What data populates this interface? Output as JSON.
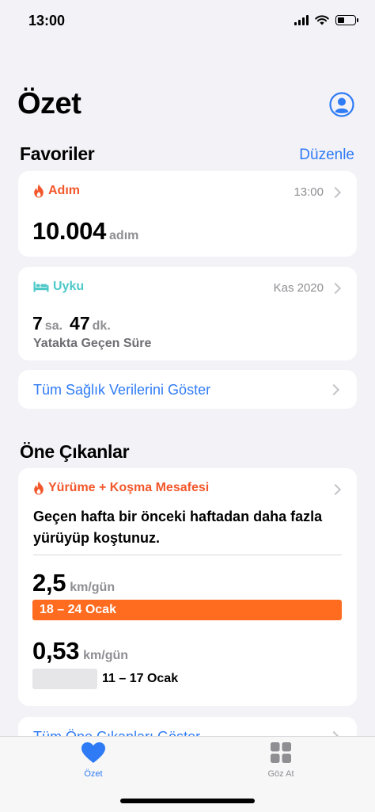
{
  "status": {
    "time": "13:00"
  },
  "header": {
    "title": "Özet"
  },
  "favorites": {
    "title": "Favoriler",
    "edit_label": "Düzenle",
    "steps": {
      "label": "Adım",
      "time": "13:00",
      "value": "10.004",
      "unit": "adım"
    },
    "sleep": {
      "label": "Uyku",
      "date": "Kas 2020",
      "hours": "7",
      "hours_unit": "sa.",
      "minutes": "47",
      "minutes_unit": "dk.",
      "caption": "Yatakta Geçen Süre"
    },
    "show_all": "Tüm Sağlık Verilerini Göster"
  },
  "highlights": {
    "title": "Öne Çıkanlar",
    "card": {
      "label": "Yürüme + Koşma Mesafesi",
      "description": "Geçen hafta bir önceki haftadan daha fazla yürüyüp koştunuz.",
      "current": {
        "value": "2,5",
        "unit": "km/gün",
        "range": "18 – 24 Ocak"
      },
      "previous": {
        "value": "0,53",
        "unit": "km/gün",
        "range": "11 – 17 Ocak"
      }
    },
    "show_all": "Tüm Öne Çıkanları Göster"
  },
  "tabbar": {
    "tabs": [
      {
        "label": "Özet",
        "active": true
      },
      {
        "label": "Göz At",
        "active": false
      }
    ]
  },
  "colors": {
    "accent_orange": "#f2572b",
    "sleep_teal": "#4fc8c8",
    "link_blue": "#2f7bf6",
    "bar_orange": "#ff6b1f",
    "bar_grey": "#e6e6e8"
  }
}
